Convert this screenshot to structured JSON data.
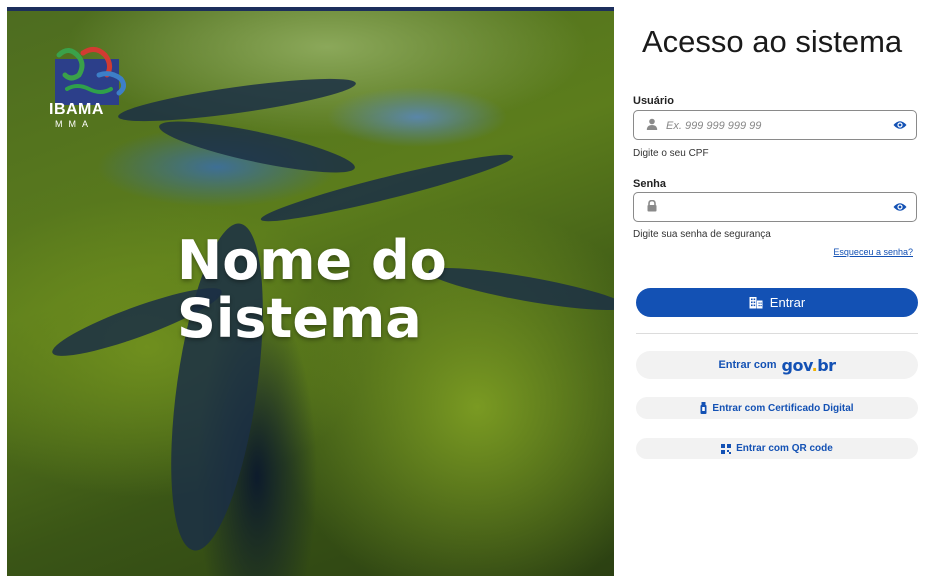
{
  "hero": {
    "title_line1": "Nome do",
    "title_line2": "Sistema",
    "logo_text": "IBAMA",
    "logo_subtext": "MMA"
  },
  "login": {
    "title": "Acesso ao sistema",
    "username": {
      "label": "Usuário",
      "placeholder": "Ex. 999 999 999 99",
      "value": "",
      "hint": "Digite o seu CPF",
      "icon": "user-icon"
    },
    "password": {
      "label": "Senha",
      "placeholder": "",
      "value": "",
      "hint": "Digite sua senha de segurança",
      "icon": "lock-icon"
    },
    "forgot_link": "Esqueceu a senha?",
    "submit_label": "Entrar",
    "govbr_prefix": "Entrar com",
    "govbr_brand_gov": "gov",
    "govbr_brand_dot": ".",
    "govbr_brand_br": "br",
    "certificate_label": "Entrar com Certificado Digital",
    "qrcode_label": "Entrar com QR code"
  },
  "colors": {
    "primary": "#1351b4",
    "govbr_yellow": "#f1b200",
    "secondary_bg": "#f2f2f2"
  }
}
